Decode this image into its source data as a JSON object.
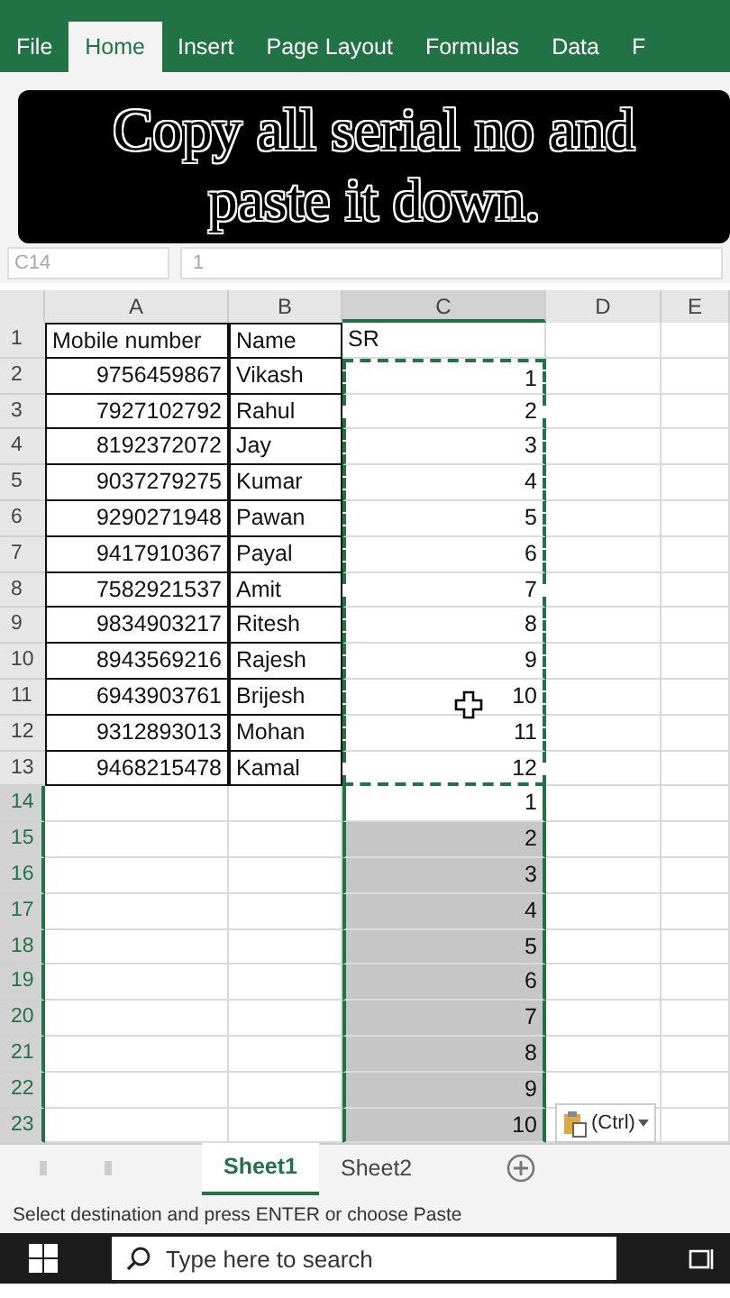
{
  "ribbon_tabs": [
    {
      "label": "File",
      "selected": false
    },
    {
      "label": "Home",
      "selected": true
    },
    {
      "label": "Insert",
      "selected": false
    },
    {
      "label": "Page Layout",
      "selected": false
    },
    {
      "label": "Formulas",
      "selected": false
    },
    {
      "label": "Data",
      "selected": false
    },
    {
      "label": "F",
      "selected": false
    }
  ],
  "caption": "Copy all serial no and paste it down.",
  "name_box": "C14",
  "formula": "1",
  "columns": [
    {
      "label": "A",
      "selected": false
    },
    {
      "label": "B",
      "selected": false
    },
    {
      "label": "C",
      "selected": true
    },
    {
      "label": "D",
      "selected": false
    },
    {
      "label": "E",
      "selected": false
    }
  ],
  "rows": [
    {
      "number": "1",
      "mobile": "Mobile number",
      "name": "Name",
      "sr": "SR",
      "copied": false,
      "selected": false
    },
    {
      "number": "2",
      "mobile": "9756459867",
      "name": "Vikash",
      "sr": "1",
      "copied": true,
      "selected": false
    },
    {
      "number": "3",
      "mobile": "7927102792",
      "name": "Rahul",
      "sr": "2",
      "copied": true,
      "selected": false
    },
    {
      "number": "4",
      "mobile": "8192372072",
      "name": "Jay",
      "sr": "3",
      "copied": true,
      "selected": false
    },
    {
      "number": "5",
      "mobile": "9037279275",
      "name": "Kumar",
      "sr": "4",
      "copied": true,
      "selected": false
    },
    {
      "number": "6",
      "mobile": "9290271948",
      "name": "Pawan",
      "sr": "5",
      "copied": true,
      "selected": false
    },
    {
      "number": "7",
      "mobile": "9417910367",
      "name": "Payal",
      "sr": "6",
      "copied": true,
      "selected": false
    },
    {
      "number": "8",
      "mobile": "7582921537",
      "name": "Amit",
      "sr": "7",
      "copied": true,
      "selected": false
    },
    {
      "number": "9",
      "mobile": "9834903217",
      "name": "Ritesh",
      "sr": "8",
      "copied": true,
      "selected": false
    },
    {
      "number": "10",
      "mobile": "8943569216",
      "name": "Rajesh",
      "sr": "9",
      "copied": true,
      "selected": false
    },
    {
      "number": "11",
      "mobile": "6943903761",
      "name": "Brijesh",
      "sr": "10",
      "copied": true,
      "selected": false
    },
    {
      "number": "12",
      "mobile": "9312893013",
      "name": "Mohan",
      "sr": "11",
      "copied": true,
      "selected": false
    },
    {
      "number": "13",
      "mobile": "9468215478",
      "name": "Kamal",
      "sr": "12",
      "copied": true,
      "selected": false
    },
    {
      "number": "14",
      "sr": "1",
      "copied": false,
      "selected": true,
      "active": true
    },
    {
      "number": "15",
      "sr": "2",
      "copied": false,
      "selected": true
    },
    {
      "number": "16",
      "sr": "3",
      "copied": false,
      "selected": true
    },
    {
      "number": "17",
      "sr": "4",
      "copied": false,
      "selected": true
    },
    {
      "number": "18",
      "sr": "5",
      "copied": false,
      "selected": true
    },
    {
      "number": "19",
      "sr": "6",
      "copied": false,
      "selected": true
    },
    {
      "number": "20",
      "sr": "7",
      "copied": false,
      "selected": true
    },
    {
      "number": "21",
      "sr": "8",
      "copied": false,
      "selected": true
    },
    {
      "number": "22",
      "sr": "9",
      "copied": false,
      "selected": true
    },
    {
      "number": "23",
      "sr": "10",
      "copied": false,
      "selected": true
    }
  ],
  "paste_options": "(Ctrl)",
  "sheet_tabs": [
    {
      "label": "Sheet1",
      "selected": true
    },
    {
      "label": "Sheet2",
      "selected": false
    }
  ],
  "status_bar": "Select destination and press ENTER or choose Paste",
  "taskbar": {
    "search_placeholder": "Type here to search"
  }
}
